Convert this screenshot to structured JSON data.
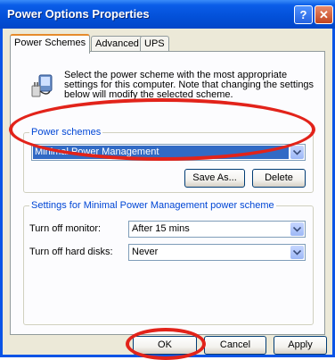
{
  "window": {
    "title": "Power Options Properties",
    "help_glyph": "?",
    "close_glyph": "✕"
  },
  "tabs": [
    {
      "label": "Power Schemes",
      "active": true
    },
    {
      "label": "Advanced",
      "active": false
    },
    {
      "label": "UPS",
      "active": false
    }
  ],
  "power_schemes_tab": {
    "description": "Select the power scheme with the most appropriate settings for this computer. Note that changing the settings below will modify the selected scheme.",
    "group_label": "Power schemes",
    "selected_scheme": "Minimal Power Management",
    "save_as_label": "Save As...",
    "delete_label": "Delete",
    "settings_group_label": "Settings for Minimal Power Management power scheme",
    "monitor_label": "Turn off monitor:",
    "monitor_value": "After 15 mins",
    "disks_label": "Turn off hard disks:",
    "disks_value": "Never"
  },
  "footer": {
    "ok_label": "OK",
    "cancel_label": "Cancel",
    "apply_label": "Apply"
  },
  "colors": {
    "titlebar": "#0a54e6",
    "selection": "#316ac5",
    "annotation_circle": "#e2231a",
    "dialog_face": "#ece9d8"
  }
}
